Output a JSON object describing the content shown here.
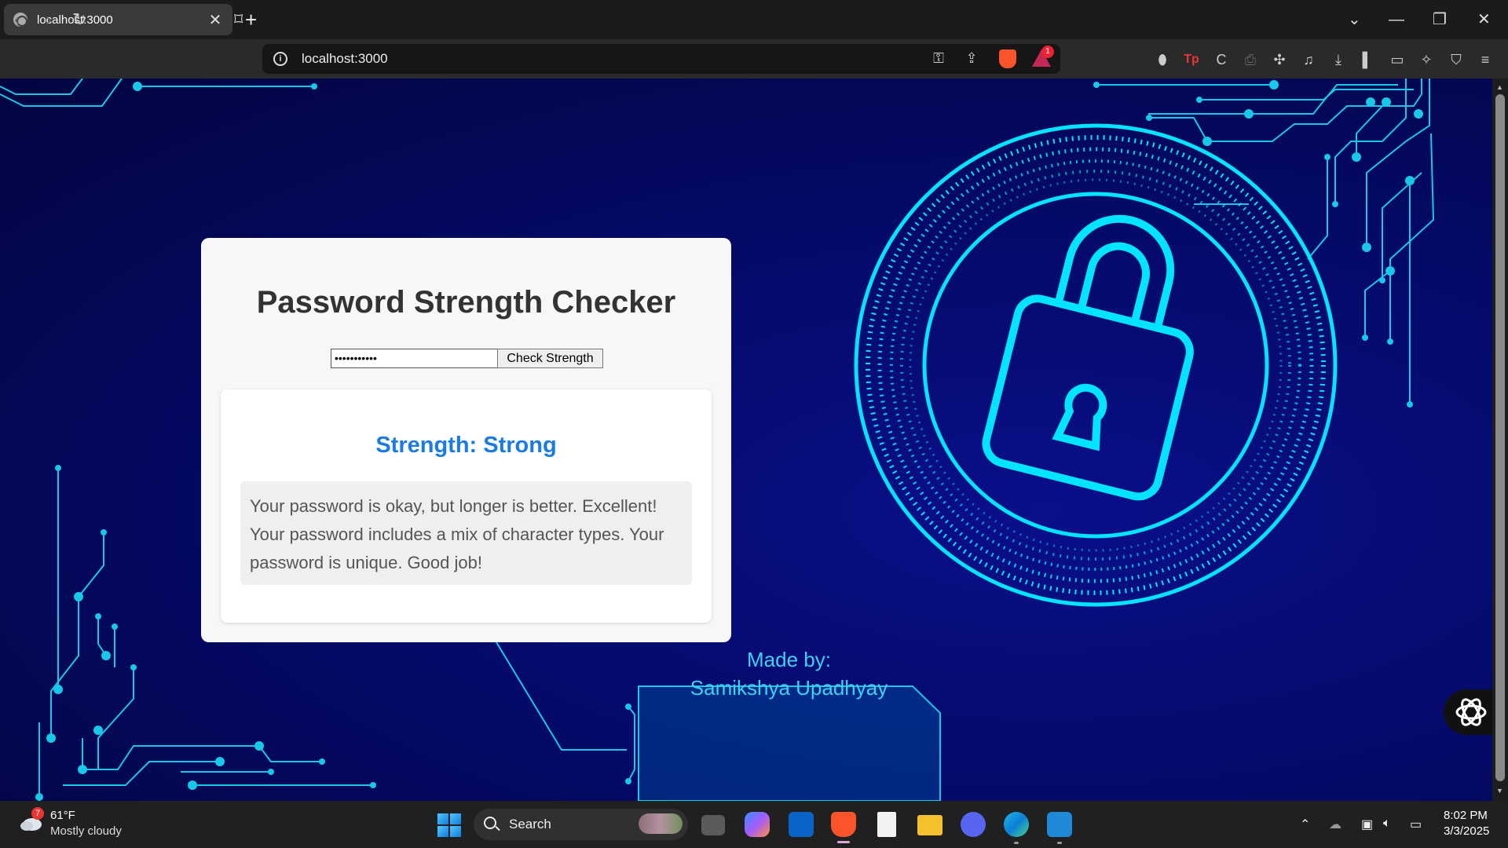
{
  "browser": {
    "tab_title": "localhost:3000",
    "tab_close": "✕",
    "new_tab": "+",
    "url": "localhost:3000",
    "rewards_count": "1",
    "window_controls": {
      "minimize": "—",
      "restore": "❐",
      "close": "✕",
      "tab_search": "⌄"
    },
    "nav": {
      "back": "‹",
      "forward": "›",
      "reload": "↻",
      "bookmark": "⌑"
    }
  },
  "app": {
    "title": "Password Strength Checker",
    "password_value": "•••••••••••",
    "check_button": "Check Strength",
    "strength_label": "Strength: Strong",
    "feedback": "Your password is okay, but longer is better. Excellent! Your password includes a mix of character types. Your password is unique. Good job!",
    "footer_line1": "Made by:",
    "footer_line2": "Samikshya Upadhyay"
  },
  "colors": {
    "accent_cyan": "#00e5ff",
    "strength_blue": "#1a7be6",
    "background_navy": "#050a6a"
  },
  "taskbar": {
    "weather_badge": "7",
    "weather_temp": "61°F",
    "weather_desc": "Mostly cloudy",
    "search_label": "Search",
    "time": "8:02 PM",
    "date": "3/3/2025"
  }
}
